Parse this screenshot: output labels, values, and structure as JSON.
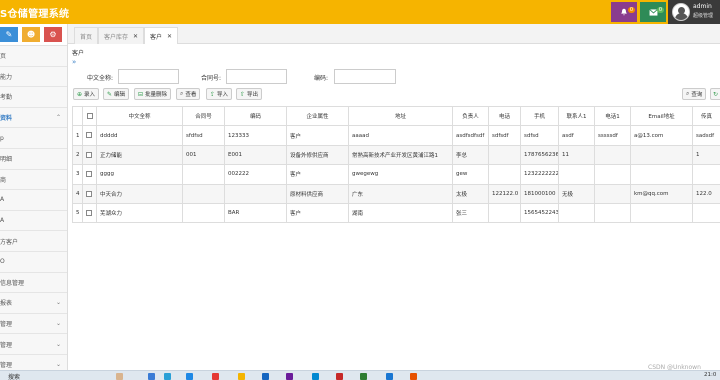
{
  "header": {
    "title": "S仓储管理系统",
    "bell_count": "0",
    "mail_count": "0",
    "user_name": "admin",
    "user_role": "超级管理"
  },
  "sidebar": {
    "items": [
      {
        "label": "页"
      },
      {
        "label": "能力"
      },
      {
        "label": "考勤"
      },
      {
        "label": "资料",
        "active": true,
        "expanded": true
      },
      {
        "label": "p"
      },
      {
        "label": "明细"
      },
      {
        "label": "商"
      },
      {
        "label": "A"
      },
      {
        "label": "A"
      },
      {
        "label": "方客户"
      },
      {
        "label": "O"
      },
      {
        "label": "信息管理"
      },
      {
        "label": "报表",
        "chevron": true
      },
      {
        "label": "管理",
        "chevron": true
      },
      {
        "label": "管理",
        "chevron": true
      },
      {
        "label": "管理",
        "chevron": true
      }
    ]
  },
  "tabs": [
    {
      "label": "首页",
      "closable": false
    },
    {
      "label": "客户库存",
      "closable": true
    },
    {
      "label": "客户",
      "closable": true,
      "active": true
    }
  ],
  "breadcrumb": "客户",
  "filters": {
    "name_label": "中文全称:",
    "name_value": "",
    "contract_label": "合同号:",
    "contract_value": "",
    "code_label": "编码:",
    "code_value": ""
  },
  "toolbar": {
    "add": "录入",
    "edit": "编辑",
    "batch_delete": "批量删除",
    "view": "查看",
    "import": "导入",
    "export": "导出",
    "search": "查询"
  },
  "table": {
    "columns": [
      "",
      "中文全称",
      "合同号",
      "编码",
      "企业属性",
      "地址",
      "负责人",
      "电话",
      "手机",
      "联系人1",
      "电话1",
      "Email地址",
      "传真"
    ],
    "rows": [
      [
        "1",
        "ddddd",
        "sfdfsd",
        "123333",
        "客户",
        "aaaad",
        "asdfsdfsdf",
        "sdfsdf",
        "sdfsd",
        "asdf",
        "sssssdf",
        "a@13.com",
        "sadsdf"
      ],
      [
        "2",
        "正力储能",
        "001",
        "E001",
        "设备外修供应商",
        "常熟高新技术产业开发区黄浦江路1",
        "李总",
        "",
        "1787656236",
        "11",
        "",
        "",
        "1"
      ],
      [
        "3",
        "gggg",
        "",
        "002222",
        "客户",
        "gwegewg",
        "gew",
        "",
        "1232222222",
        "",
        "",
        "",
        ""
      ],
      [
        "4",
        "中天合力",
        "",
        "",
        "原材料供应商",
        "广东",
        "太极",
        "122122.0",
        "181000100",
        "无极",
        "",
        "km@qq.com",
        "122.0"
      ],
      [
        "5",
        "芜湖众力",
        "",
        "BAR",
        "客户",
        "湖南",
        "张三",
        "",
        "1565452243",
        "",
        "",
        "",
        ""
      ]
    ]
  },
  "taskbar": {
    "search_text": "搜索",
    "time": "21:0",
    "watermark": "CSDN @Unknown"
  }
}
